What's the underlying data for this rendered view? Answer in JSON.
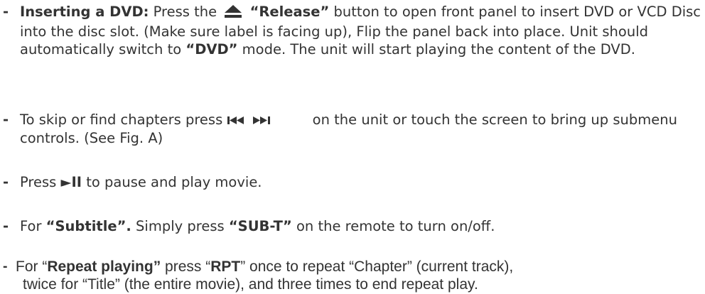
{
  "items": [
    {
      "dash": "-",
      "title": "Inserting a DVD:",
      "t1": " Press the ",
      "eject_icon": "eject-icon",
      "release": "“Release”",
      "t2": " button to open front panel to insert DVD or VCD Disc into the disc slot. (Make sure label is facing up), Flip the panel back into place. Unit should automatically switch to ",
      "dvd": "“DVD”",
      "t3": " mode. The unit will start playing the content of the DVD."
    },
    {
      "dash": "-",
      "t1": "To skip or find chapters press ",
      "skip_icons": "previous-next-icons",
      "t2": " on the unit or touch the screen to bring up submenu controls. (See Fig. A)"
    },
    {
      "dash": "-",
      "t1": "Press ",
      "play_pause": "►II",
      "t2": " to pause and play movie."
    },
    {
      "dash": "-",
      "t1": "For ",
      "subtitle": "“Subtitle”.",
      "t2": " Simply press ",
      "subt": "“SUB-T”",
      "t3": " on the remote to turn on/off."
    },
    {
      "dash": "-",
      "t1": "For “",
      "repeat": "Repeat playing”",
      "t2": " press “",
      "rpt": "RPT",
      "t3": "” once to repeat “Chapter” (current track),",
      "t4": "twice for “Title” (the entire movie), and three times to end repeat play."
    }
  ]
}
